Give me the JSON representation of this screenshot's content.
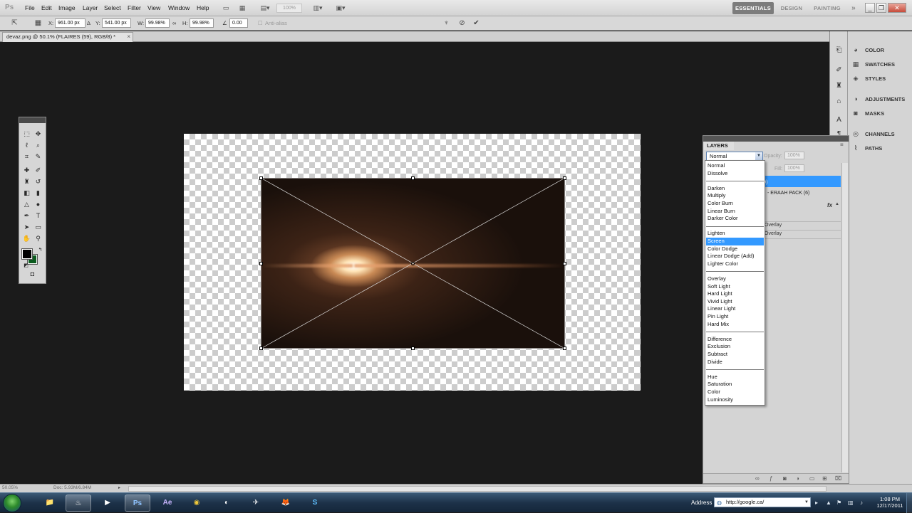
{
  "app": {
    "logo": "Ps",
    "menus": [
      "File",
      "Edit",
      "Image",
      "Layer",
      "Select",
      "Filter",
      "View",
      "Window",
      "Help"
    ],
    "zoom_level": "100%",
    "workspaces": [
      "ESSENTIALS",
      "DESIGN",
      "PAINTING"
    ],
    "active_workspace": "ESSENTIALS",
    "more_workspaces": "»",
    "window_controls": {
      "minimize": "_",
      "restore": "❐",
      "close": "✕"
    }
  },
  "options_bar": {
    "x_label": "X:",
    "x_value": "961.00 px",
    "y_label": "Y:",
    "y_value": "541.00 px",
    "w_label": "W:",
    "w_value": "99.98%",
    "h_label": "H:",
    "h_value": "99.98%",
    "angle_value": "0.00",
    "antialias_label": "Anti-alias",
    "cancel_symbol": "⊘",
    "commit_symbol": "✔"
  },
  "document": {
    "tab_title": "devaz.png @ 50.1% (FLAIRES (59), RGB/8) *",
    "tab_close": "×"
  },
  "layers_panel": {
    "tab_label": "LAYERS",
    "blend_mode": "Normal",
    "opacity_label": "Opacity:",
    "opacity_value": "100%",
    "fill_label": "Fill:",
    "fill_value": "100%",
    "selected_layer_text": "9)",
    "second_layer_text": "- ERAAH PACK (6)",
    "fx_label": "fx",
    "effects": [
      "Overlay",
      "Overlay"
    ]
  },
  "blend_modes": {
    "groups": [
      [
        "Normal",
        "Dissolve"
      ],
      [
        "Darken",
        "Multiply",
        "Color Burn",
        "Linear Burn",
        "Darker Color"
      ],
      [
        "Lighten",
        "Screen",
        "Color Dodge",
        "Linear Dodge (Add)",
        "Lighter Color"
      ],
      [
        "Overlay",
        "Soft Light",
        "Hard Light",
        "Vivid Light",
        "Linear Light",
        "Pin Light",
        "Hard Mix"
      ],
      [
        "Difference",
        "Exclusion",
        "Subtract",
        "Divide"
      ],
      [
        "Hue",
        "Saturation",
        "Color",
        "Luminosity"
      ]
    ],
    "highlighted": "Screen"
  },
  "right_panels": [
    {
      "label": "COLOR",
      "icon": "color-wheel-icon"
    },
    {
      "label": "SWATCHES",
      "icon": "swatches-grid-icon"
    },
    {
      "label": "STYLES",
      "icon": "styles-icon"
    },
    {
      "label": "ADJUSTMENTS",
      "icon": "adjustments-icon"
    },
    {
      "label": "MASKS",
      "icon": "masks-icon"
    },
    {
      "label": "CHANNELS",
      "icon": "channels-icon"
    },
    {
      "label": "PATHS",
      "icon": "paths-icon"
    }
  ],
  "status_bar": {
    "zoom": "50.05%",
    "doc_info": "Doc: 5.93M/6.84M",
    "arrow": "▸"
  },
  "taskbar": {
    "apps": [
      {
        "name": "explorer",
        "label": "📁"
      },
      {
        "name": "steam",
        "label": "♨"
      },
      {
        "name": "media-player",
        "label": "▶"
      },
      {
        "name": "photoshop",
        "label": "Ps"
      },
      {
        "name": "after-effects",
        "label": "Ae"
      },
      {
        "name": "chrome",
        "label": "◉"
      },
      {
        "name": "app-7",
        "label": "◐"
      },
      {
        "name": "app-8",
        "label": "✈"
      },
      {
        "name": "firefox",
        "label": "🦊"
      },
      {
        "name": "skype",
        "label": "S"
      }
    ],
    "address_label": "Address",
    "address_value": "http://google.ca/",
    "clock_time": "1:08 PM",
    "clock_date": "12/17/2011"
  },
  "colors": {
    "accent": "#3399ff",
    "foreground_swatch": "#000000",
    "background_swatch": "#0b5b1e",
    "canvas_bg": "#1b1b1b"
  }
}
